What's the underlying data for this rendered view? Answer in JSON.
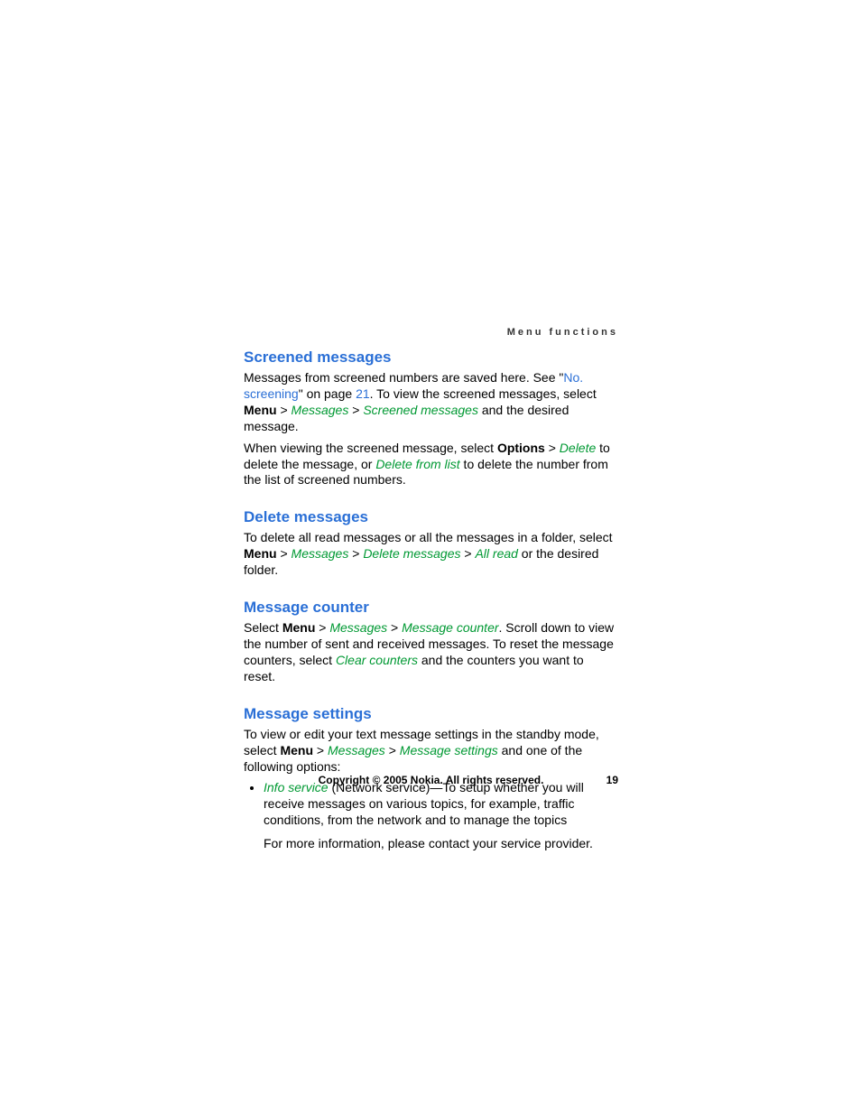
{
  "running_header": "Menu functions",
  "sections": {
    "screened": {
      "title": "Screened messages",
      "p1_a": "Messages from screened numbers are saved here. See \"",
      "p1_link": "No. screening",
      "p1_b": "\" on page ",
      "p1_pagelink": "21",
      "p1_c": ". To view the screened messages, select ",
      "p1_menu": "Menu",
      "p1_gt1": " > ",
      "p1_messages": "Messages",
      "p1_gt2": " > ",
      "p1_screened": "Screened messages",
      "p1_d": " and the desired message.",
      "p2_a": "When viewing the screened message, select ",
      "p2_options": "Options",
      "p2_gt1": " > ",
      "p2_delete": "Delete",
      "p2_b": " to delete the message, or ",
      "p2_delfromlist": "Delete from list",
      "p2_c": " to delete the number from the list of screened numbers."
    },
    "delete": {
      "title": "Delete messages",
      "p1_a": "To delete all read messages or all the messages in a folder, select ",
      "p1_menu": "Menu",
      "p1_gt1": " > ",
      "p1_messages": "Messages",
      "p1_gt2": " > ",
      "p1_delmsg": "Delete messages",
      "p1_gt3": " > ",
      "p1_allread": "All read",
      "p1_b": " or the desired folder."
    },
    "counter": {
      "title": "Message counter",
      "p1_a": "Select ",
      "p1_menu": "Menu",
      "p1_gt1": " > ",
      "p1_messages": "Messages",
      "p1_gt2": " > ",
      "p1_msgcounter": "Message counter",
      "p1_b": ". Scroll down to view the number of sent and received messages. To reset the message counters, select ",
      "p1_clear": "Clear counters",
      "p1_c": " and the counters you want to reset."
    },
    "settings": {
      "title": "Message settings",
      "p1_a": "To view or edit your text message settings in the standby mode, select ",
      "p1_menu": "Menu",
      "p1_gt1": " > ",
      "p1_messages": "Messages",
      "p1_gt2": " > ",
      "p1_msgsettings": "Message settings",
      "p1_b": " and one of the following options:",
      "li1_info": "Info service",
      "li1_a": " (Network service)—To setup whether you will receive messages on various topics, for example, traffic conditions, from the network and to manage the topics",
      "li1_sub": "For more information, please contact your service provider."
    }
  },
  "footer": {
    "copyright": "Copyright © 2005 Nokia. All rights reserved.",
    "page": "19"
  }
}
